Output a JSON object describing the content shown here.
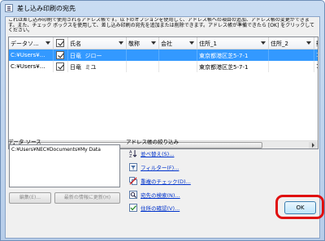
{
  "window": {
    "title": "差し込み印刷の宛先"
  },
  "description": "これは差し込み印刷で使用されるアドレス帳です。以下のオプションを使用して、アドレス帳への項目の追加、アドレス帳の変更ができます。また、チェック ボックスを使用して、差し込み印刷の宛先を追加または削除できます。アドレス帳が準備できたら [OK] をクリックしてください。",
  "grid": {
    "columns": [
      "データソ...",
      "",
      "氏名",
      "敬称",
      "会社",
      "住所_1",
      "住所_2",
      "郵"
    ],
    "rows": [
      {
        "source": "C:¥Users¥...",
        "checked": true,
        "col3": "日竜",
        "col4": "ジロー",
        "col5": "",
        "address1": "東京都港区芝5-7-1",
        "address2": "",
        "postal": "108",
        "selected": true
      },
      {
        "source": "C:¥Users¥...",
        "checked": true,
        "col3": "日竜",
        "col4": "ミユ",
        "col5": "",
        "address1": "東京都港区芝5-7-1",
        "address2": "",
        "postal": "108",
        "selected": false
      }
    ]
  },
  "datasource": {
    "label": "データ ソース",
    "items": [
      "C:¥Users¥NEC¥Documents¥My Data"
    ],
    "edit_label": "編集(E)...",
    "refresh_label": "最新の情報に更新(H)"
  },
  "refine": {
    "label": "アドレス帳の絞り込み",
    "links": [
      {
        "icon": "sort-icon",
        "label": "並べ替え(S)..."
      },
      {
        "icon": "filter-icon",
        "label": "フィルター(F)..."
      },
      {
        "icon": "duplicates-icon",
        "label": "重複のチェック(D)..."
      },
      {
        "icon": "find-recipient-icon",
        "label": "宛先の検索(N)..."
      },
      {
        "icon": "validate-address-icon",
        "label": "住所の確認(V)..."
      }
    ]
  },
  "footer": {
    "ok_label": "OK"
  },
  "colors": {
    "selection": "#3399ff",
    "link": "#0033cc",
    "highlight": "#e01010"
  }
}
